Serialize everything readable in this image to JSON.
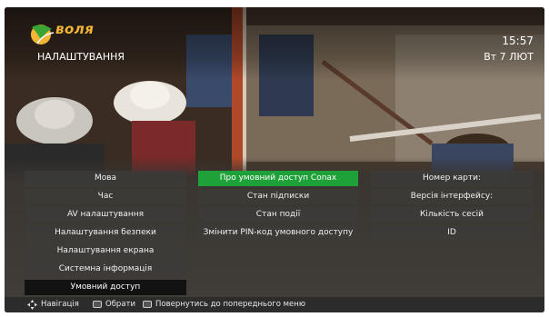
{
  "header": {
    "logo_text": "воля",
    "title": "НАЛАШТУВАННЯ",
    "time": "15:57",
    "date": "Вт 7 ЛЮТ"
  },
  "menu": {
    "left": [
      {
        "label": "Мова"
      },
      {
        "label": "Час"
      },
      {
        "label": "AV налаштування"
      },
      {
        "label": "Налаштування безпеки"
      },
      {
        "label": "Налаштування екрана"
      },
      {
        "label": "Системна інформація"
      },
      {
        "label": "Умовний доступ"
      }
    ],
    "middle": [
      {
        "label": "Про умовний доступ Conax"
      },
      {
        "label": "Стан підписки"
      },
      {
        "label": "Стан події"
      },
      {
        "label": "Змінити PIN-код умовного доступу"
      }
    ],
    "right": [
      {
        "label": "Номер карти:"
      },
      {
        "label": "Версія інтерфейсу:"
      },
      {
        "label": "Кількість сесій"
      },
      {
        "label": "ID"
      }
    ]
  },
  "footer": {
    "nav_icon": "navigation-arrows-icon",
    "nav_label": "Навігація",
    "ok_icon": "ok-key-icon",
    "ok_label": "Обрати",
    "back_icon": "back-key-icon",
    "back_label": "Повернутись до попереднього меню"
  },
  "colors": {
    "highlight": "#1fa13a",
    "current": "#121212",
    "logo_orange": "#f2b535",
    "logo_green": "#3aa535"
  }
}
